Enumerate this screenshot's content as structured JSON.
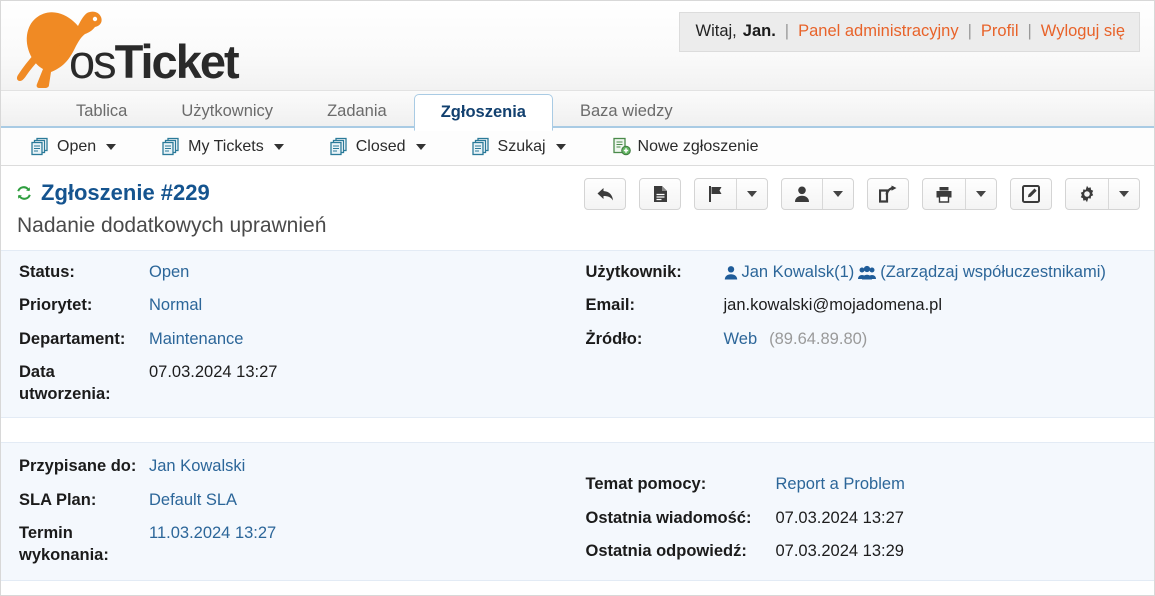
{
  "brand": {
    "name_part1": "os",
    "name_part2": "Ticket",
    "accent": "#f08a24"
  },
  "userbar": {
    "greeting": "Witaj,",
    "username": "Jan.",
    "links": [
      "Panel administracyjny",
      "Profil",
      "Wyloguj się"
    ],
    "link_color": "#e8632a"
  },
  "tabs": [
    {
      "label": "Tablica",
      "active": false
    },
    {
      "label": "Użytkownicy",
      "active": false
    },
    {
      "label": "Zadania",
      "active": false
    },
    {
      "label": "Zgłoszenia",
      "active": true
    },
    {
      "label": "Baza wiedzy",
      "active": false
    }
  ],
  "subnav": [
    {
      "label": "Open",
      "icon": "tickets-icon",
      "caret": true
    },
    {
      "label": "My Tickets",
      "icon": "tickets-icon",
      "caret": true
    },
    {
      "label": "Closed",
      "icon": "tickets-icon",
      "caret": true
    },
    {
      "label": "Szukaj",
      "icon": "tickets-icon",
      "caret": true
    },
    {
      "label": "Nowe zgłoszenie",
      "icon": "new-ticket-icon",
      "caret": false
    }
  ],
  "ticket": {
    "number_title": "Zgłoszenie #229",
    "subject": "Nadanie dodatkowych uprawnień",
    "refresh_icon": "refresh-icon"
  },
  "toolbar": [
    {
      "name": "reply-button",
      "icon": "reply-arrow-icon",
      "dropdown": false
    },
    {
      "name": "note-button",
      "icon": "document-icon",
      "dropdown": false
    },
    {
      "name": "flag-button",
      "icon": "flag-icon",
      "dropdown": true
    },
    {
      "name": "assign-button",
      "icon": "user-icon",
      "dropdown": true
    },
    {
      "name": "transfer-button",
      "icon": "forward-icon",
      "dropdown": false
    },
    {
      "name": "print-button",
      "icon": "printer-icon",
      "dropdown": true
    },
    {
      "name": "edit-button",
      "icon": "edit-icon",
      "dropdown": false
    },
    {
      "name": "settings-button",
      "icon": "gear-icon",
      "dropdown": true
    }
  ],
  "details": {
    "left": [
      {
        "label": "Status:",
        "value": "Open",
        "link": true
      },
      {
        "label": "Priorytet:",
        "value": "Normal",
        "link": true
      },
      {
        "label": "Departament:",
        "value": "Maintenance",
        "link": true
      },
      {
        "label": "Data utworzenia:",
        "value": "07.03.2024 13:27",
        "link": false
      }
    ],
    "right": {
      "user_label": "Użytkownik:",
      "user_name": "Jan Kowalsk(1)",
      "collaborators": "(Zarządzaj współuczestnikami)",
      "email_label": "Email:",
      "email_value": "jan.kowalski@mojadomena.pl",
      "source_label": "Żródło:",
      "source_value": "Web",
      "source_ip": "(89.64.89.80)"
    }
  },
  "details2": {
    "left": [
      {
        "label": "Przypisane do:",
        "value": "Jan Kowalski",
        "link": true
      },
      {
        "label": "SLA Plan:",
        "value": "Default SLA",
        "link": true
      },
      {
        "label": "Termin wykonania:",
        "value": "11.03.2024 13:27",
        "link": true
      }
    ],
    "right": [
      {
        "label": "Temat pomocy:",
        "value": "Report a Problem",
        "link": true
      },
      {
        "label": "Ostatnia wiadomość:",
        "value": "07.03.2024 13:27",
        "link": false
      },
      {
        "label": "Ostatnia odpowiedź:",
        "value": "07.03.2024 13:29",
        "link": false
      }
    ]
  }
}
